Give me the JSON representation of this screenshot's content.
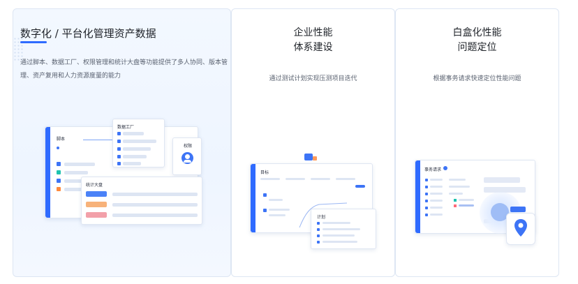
{
  "cards": [
    {
      "title": "数字化 / 平台化管理资产数据",
      "description": "通过脚本、数据工厂、权限管理和统计大盘等功能提供了多人协同、版本管理、资产复用和人力资源度量的能力",
      "illustration": {
        "script_label": "脚本",
        "data_factory_label": "数据工厂",
        "permission_label": "权限",
        "dashboard_label": "统计大盘"
      }
    },
    {
      "title_lines": [
        "企业性能",
        "体系建设"
      ],
      "subtitle": "通过测试计划实现压测项目迭代",
      "illustration": {
        "target_label": "目标",
        "plan_label": "计划"
      }
    },
    {
      "title_lines": [
        "白盒化性能",
        "问题定位"
      ],
      "subtitle": "根据事务请求快速定位性能问题",
      "illustration": {
        "transaction_label": "事务请求"
      }
    }
  ],
  "colors": {
    "accent": "#2f6bff",
    "title_text": "#1f2329",
    "body_text": "#5a6270",
    "card_border": "#dde6f3"
  }
}
